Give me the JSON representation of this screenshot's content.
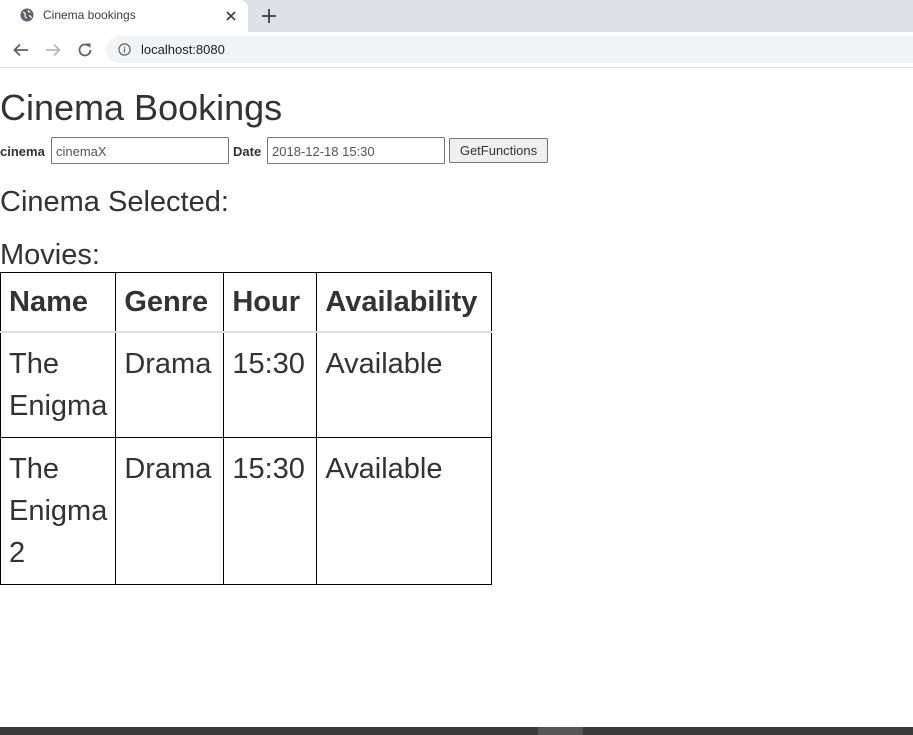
{
  "browser": {
    "tab_title": "Cinema bookings",
    "url": "localhost:8080",
    "tab_icon": "globe-icon",
    "close_icon": "close-icon",
    "new_tab_icon": "plus-icon",
    "back_icon": "back-arrow-icon",
    "forward_icon": "forward-arrow-icon",
    "reload_icon": "reload-icon",
    "info_icon": "info-icon"
  },
  "page": {
    "title": "Cinema Bookings",
    "form": {
      "cinema_label": "cinema",
      "cinema_value": "cinemaX",
      "date_label": "Date",
      "date_value": "2018-12-18 15:30",
      "button_label": "GetFunctions"
    },
    "cinema_selected_label": "Cinema Selected:",
    "movies_label": "Movies:",
    "table": {
      "headers": [
        "Name",
        "Genre",
        "Hour",
        "Availability"
      ],
      "rows": [
        [
          "The Enigma",
          "Drama",
          "15:30",
          "Available"
        ],
        [
          "The Enigma 2",
          "Drama",
          "15:30",
          "Available"
        ]
      ]
    }
  },
  "colors": {
    "tabstrip": "#dee1e6",
    "omnibox": "#f1f3f4",
    "text": "#333333"
  }
}
